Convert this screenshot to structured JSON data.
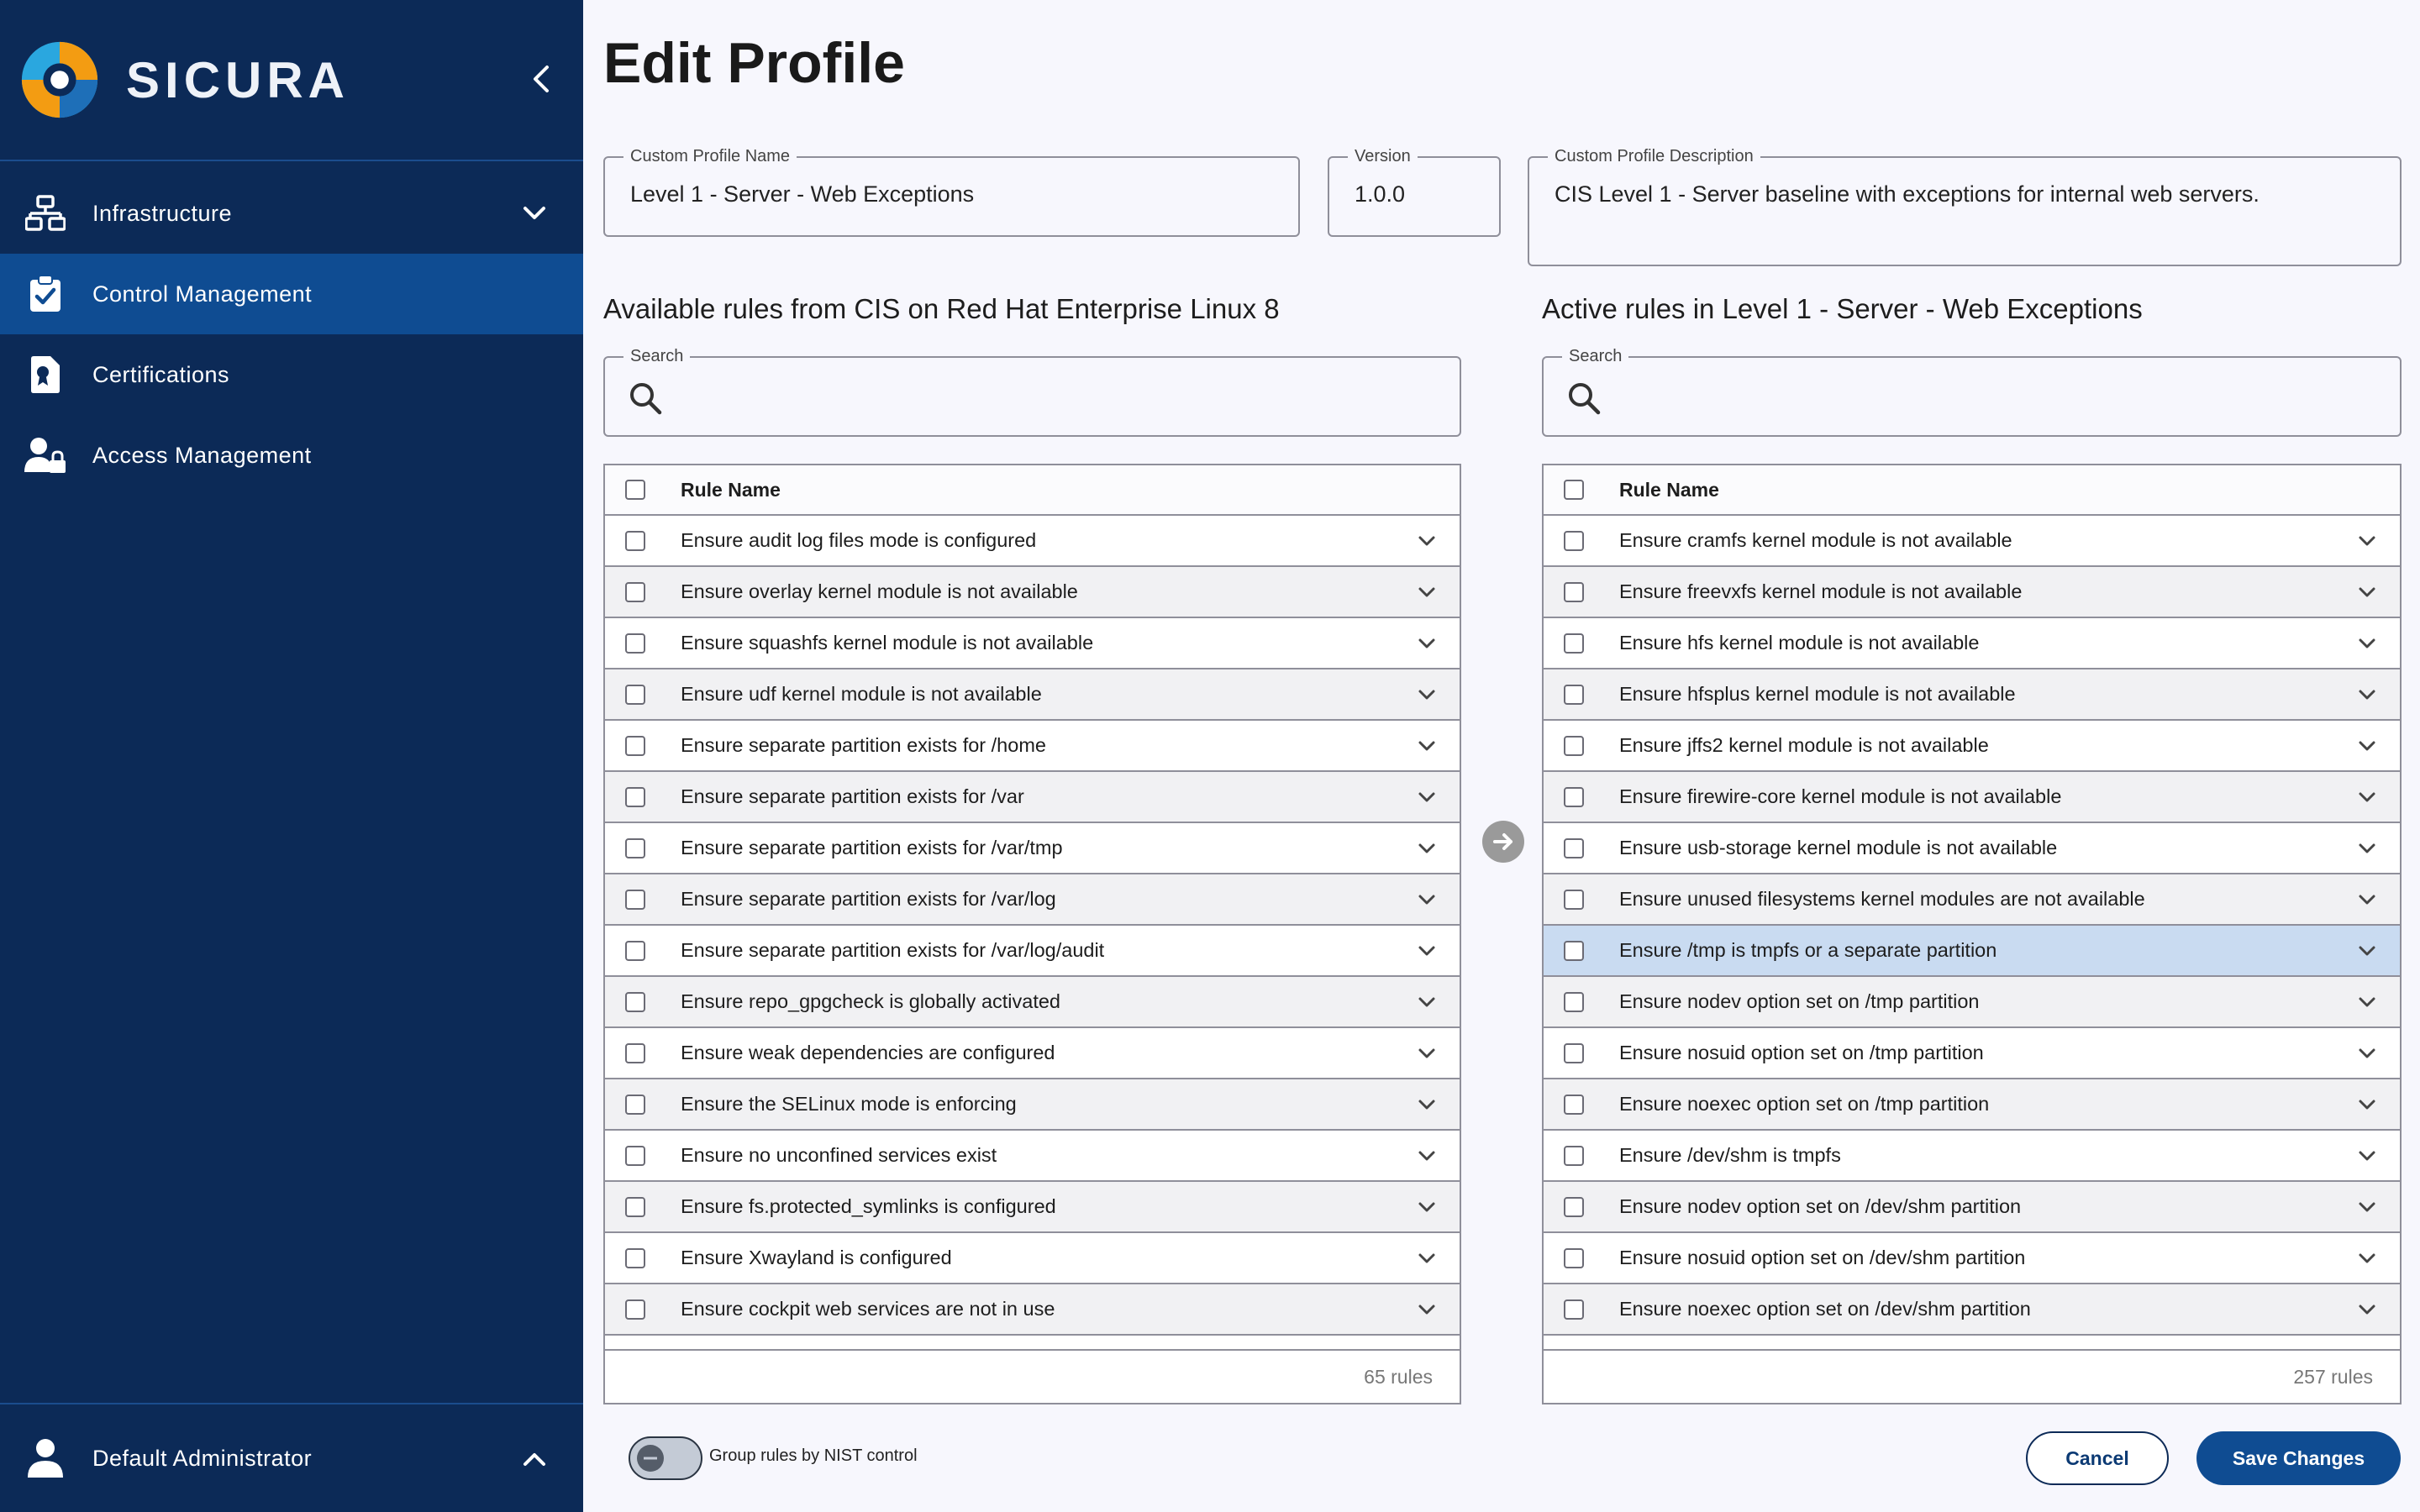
{
  "brand": {
    "name": "SICURA"
  },
  "sidebar": {
    "items": [
      {
        "label": "Infrastructure",
        "icon": "network-icon",
        "active": false,
        "expandable": true
      },
      {
        "label": "Control Management",
        "icon": "clipboard-check-icon",
        "active": true
      },
      {
        "label": "Certifications",
        "icon": "certificate-document-icon",
        "active": false
      },
      {
        "label": "Access Management",
        "icon": "user-lock-icon",
        "active": false
      }
    ],
    "footer": {
      "label": "Default Administrator",
      "icon": "user-icon"
    }
  },
  "page": {
    "title": "Edit Profile"
  },
  "form": {
    "name": {
      "legend": "Custom Profile Name",
      "value": "Level 1 - Server - Web Exceptions"
    },
    "version": {
      "legend": "Version",
      "value": "1.0.0"
    },
    "description": {
      "legend": "Custom Profile Description",
      "value": "CIS Level 1 - Server baseline with exceptions for internal web servers."
    }
  },
  "available": {
    "title": "Available rules from CIS on Red Hat Enterprise Linux 8",
    "search_legend": "Search",
    "column_header": "Rule Name",
    "count_label": "65 rules",
    "rows": [
      "Ensure audit log files mode is configured",
      "Ensure overlay kernel module is not available",
      "Ensure squashfs kernel module is not available",
      "Ensure udf kernel module is not available",
      "Ensure separate partition exists for /home",
      "Ensure separate partition exists for /var",
      "Ensure separate partition exists for /var/tmp",
      "Ensure separate partition exists for /var/log",
      "Ensure separate partition exists for /var/log/audit",
      "Ensure repo_gpgcheck is globally activated",
      "Ensure weak dependencies are configured",
      "Ensure the SELinux mode is enforcing",
      "Ensure no unconfined services exist",
      "Ensure fs.protected_symlinks is configured",
      "Ensure Xwayland is configured",
      "Ensure cockpit web services are not in use"
    ]
  },
  "active": {
    "title": "Active rules in Level 1 - Server - Web Exceptions",
    "search_legend": "Search",
    "column_header": "Rule Name",
    "count_label": "257 rules",
    "selected_index": 8,
    "rows": [
      "Ensure cramfs kernel module is not available",
      "Ensure freevxfs kernel module is not available",
      "Ensure hfs kernel module is not available",
      "Ensure hfsplus kernel module is not available",
      "Ensure jffs2 kernel module is not available",
      "Ensure firewire-core kernel module is not available",
      "Ensure usb-storage kernel module is not available",
      "Ensure unused filesystems kernel modules are not available",
      "Ensure /tmp is tmpfs or a separate partition",
      "Ensure nodev option set on /tmp partition",
      "Ensure nosuid option set on /tmp partition",
      "Ensure noexec option set on /tmp partition",
      "Ensure /dev/shm is tmpfs",
      "Ensure nodev option set on /dev/shm partition",
      "Ensure nosuid option set on /dev/shm partition",
      "Ensure noexec option set on /dev/shm partition"
    ]
  },
  "footer": {
    "toggle_label": "Group rules by NIST control",
    "toggle_on": false,
    "cancel_label": "Cancel",
    "save_label": "Save Changes"
  },
  "colors": {
    "sidebar_bg": "#0c2a57",
    "active_nav": "#0f4c92",
    "primary_button": "#0f4c92",
    "selected_row": "#c9dbf1"
  }
}
